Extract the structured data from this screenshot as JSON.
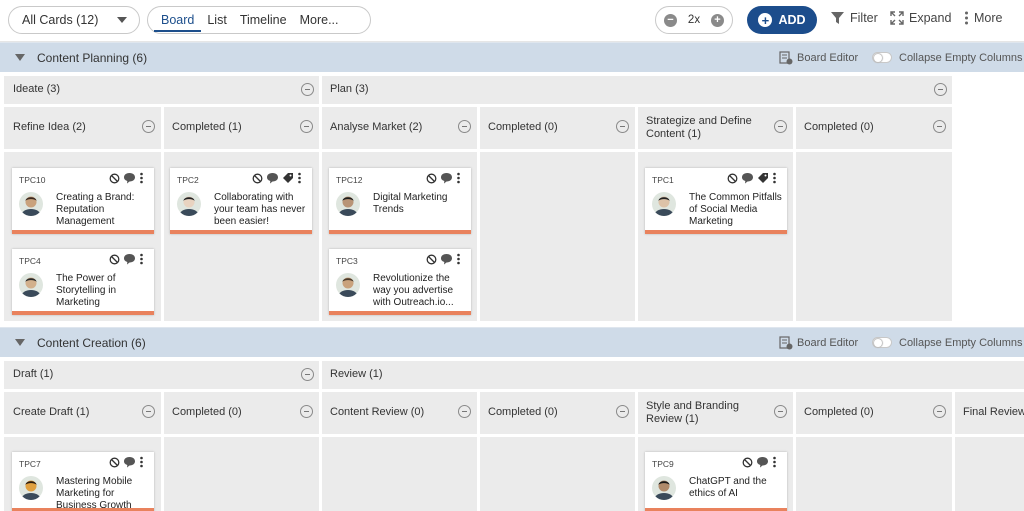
{
  "toolbar": {
    "all_cards": "All Cards (12)",
    "views": [
      "Board",
      "List",
      "Timeline",
      "More..."
    ],
    "zoom": "2x",
    "add": "ADD",
    "filter": "Filter",
    "expand": "Expand",
    "more": "More"
  },
  "sections": [
    {
      "title": "Content Planning (6)",
      "board_editor": "Board Editor",
      "collapse": "Collapse Empty Columns",
      "groups": [
        "Ideate (3)",
        "Plan (3)"
      ],
      "columns": [
        "Refine Idea (2)",
        "Completed (1)",
        "Analyse Market (2)",
        "Completed (0)",
        "Strategize and Define Content (1)",
        "Completed (0)"
      ]
    },
    {
      "title": "Content Creation (6)",
      "board_editor": "Board Editor",
      "collapse": "Collapse Empty Columns",
      "groups": [
        "Draft (1)",
        "Review (1)"
      ],
      "columns": [
        "Create Draft (1)",
        "Completed (0)",
        "Content Review (0)",
        "Completed (0)",
        "Style and Branding Review (1)",
        "Completed (0)",
        "Final Review"
      ]
    }
  ],
  "cards": [
    {
      "id": "TPC10",
      "title": "Creating a Brand: Reputation Management",
      "tag": false
    },
    {
      "id": "TPC4",
      "title": "The Power of Storytelling in Marketing",
      "tag": false
    },
    {
      "id": "TPC2",
      "title": "Collaborating with your team has never been easier!",
      "tag": true
    },
    {
      "id": "TPC12",
      "title": "Digital Marketing Trends",
      "tag": false
    },
    {
      "id": "TPC3",
      "title": "Revolutionize the way you advertise with Outreach.io...",
      "tag": false
    },
    {
      "id": "TPC1",
      "title": "The Common Pitfalls of Social Media Marketing",
      "tag": true
    },
    {
      "id": "TPC7",
      "title": "Mastering Mobile Marketing for Business Growth",
      "tag": false
    },
    {
      "id": "TPC9",
      "title": "ChatGPT and the ethics of AI",
      "tag": false
    }
  ],
  "colors": {
    "accent": "#1c4d8c",
    "section_bar": "#cfdbe8",
    "column_bg": "#ebebeb",
    "card_stripe": "#e9825d"
  }
}
